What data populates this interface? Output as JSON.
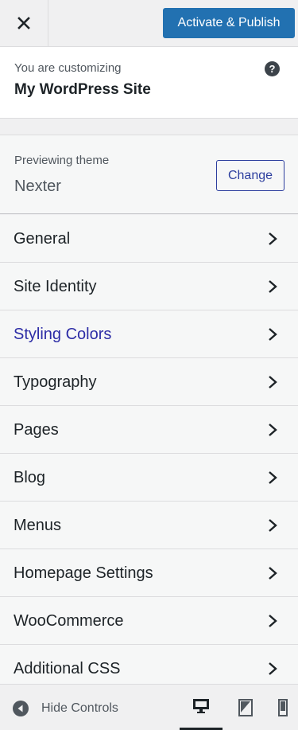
{
  "header": {
    "close_icon": "close-icon",
    "publish_label": "Activate & Publish"
  },
  "info": {
    "pre": "You are customizing",
    "title": "My WordPress Site",
    "help_icon": "help-icon",
    "help_glyph": "?"
  },
  "theme": {
    "pre": "Previewing theme",
    "name": "Nexter",
    "change_label": "Change"
  },
  "menu": {
    "items": [
      {
        "label": "General"
      },
      {
        "label": "Site Identity"
      },
      {
        "label": "Styling Colors"
      },
      {
        "label": "Typography"
      },
      {
        "label": "Pages"
      },
      {
        "label": "Blog"
      },
      {
        "label": "Menus"
      },
      {
        "label": "Homepage Settings"
      },
      {
        "label": "WooCommerce"
      },
      {
        "label": "Additional CSS"
      }
    ],
    "active_index": 2
  },
  "footer": {
    "hide_label": "Hide Controls",
    "devices": [
      "desktop-icon",
      "tablet-icon",
      "mobile-icon"
    ],
    "selected_device": "desktop"
  },
  "colors": {
    "accent": "#2271b1",
    "active_link": "#2c2ca6",
    "background": "#f0f0f1"
  }
}
